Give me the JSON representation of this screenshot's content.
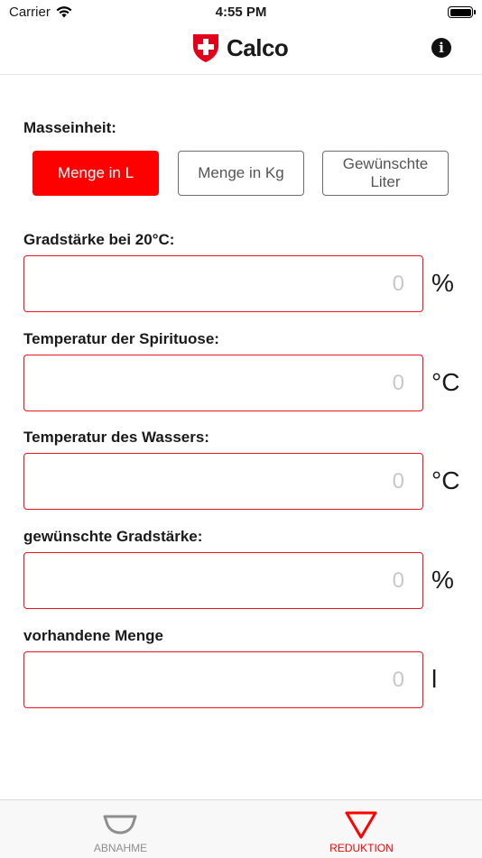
{
  "status_bar": {
    "carrier": "Carrier",
    "time": "4:55 PM"
  },
  "nav": {
    "title": "Calco",
    "logo": "swiss-cross-shield-icon",
    "info_icon": "info-icon"
  },
  "measure": {
    "label": "Masseinheit:",
    "options": [
      "Menge in L",
      "Menge in Kg",
      "Gewünschte Liter"
    ],
    "options_lines": [
      [
        "Menge in L"
      ],
      [
        "Menge in Kg"
      ],
      [
        "Gewünschte",
        "Liter"
      ]
    ],
    "selected": "Menge in L"
  },
  "fields": [
    {
      "label": "Gradstärke bei 20°C:",
      "value": "0",
      "unit": "%"
    },
    {
      "label": "Temperatur der Spirituose:",
      "value": "0",
      "unit": "°C"
    },
    {
      "label": "Temperatur des Wassers:",
      "value": "0",
      "unit": "°C"
    },
    {
      "label": "gewünschte Gradstärke:",
      "value": "0",
      "unit": "%"
    },
    {
      "label": "vorhandene Menge",
      "value": "0",
      "unit": "l"
    }
  ],
  "tabs": [
    {
      "label": "ABNAHME",
      "icon": "bowl-icon",
      "active": false
    },
    {
      "label": "REDUKTION",
      "icon": "triangle-down-icon",
      "active": true
    }
  ],
  "colors": {
    "accent": "#ff0000",
    "field_border": "#e8151b",
    "inactive_tab": "#8e8e8e"
  }
}
